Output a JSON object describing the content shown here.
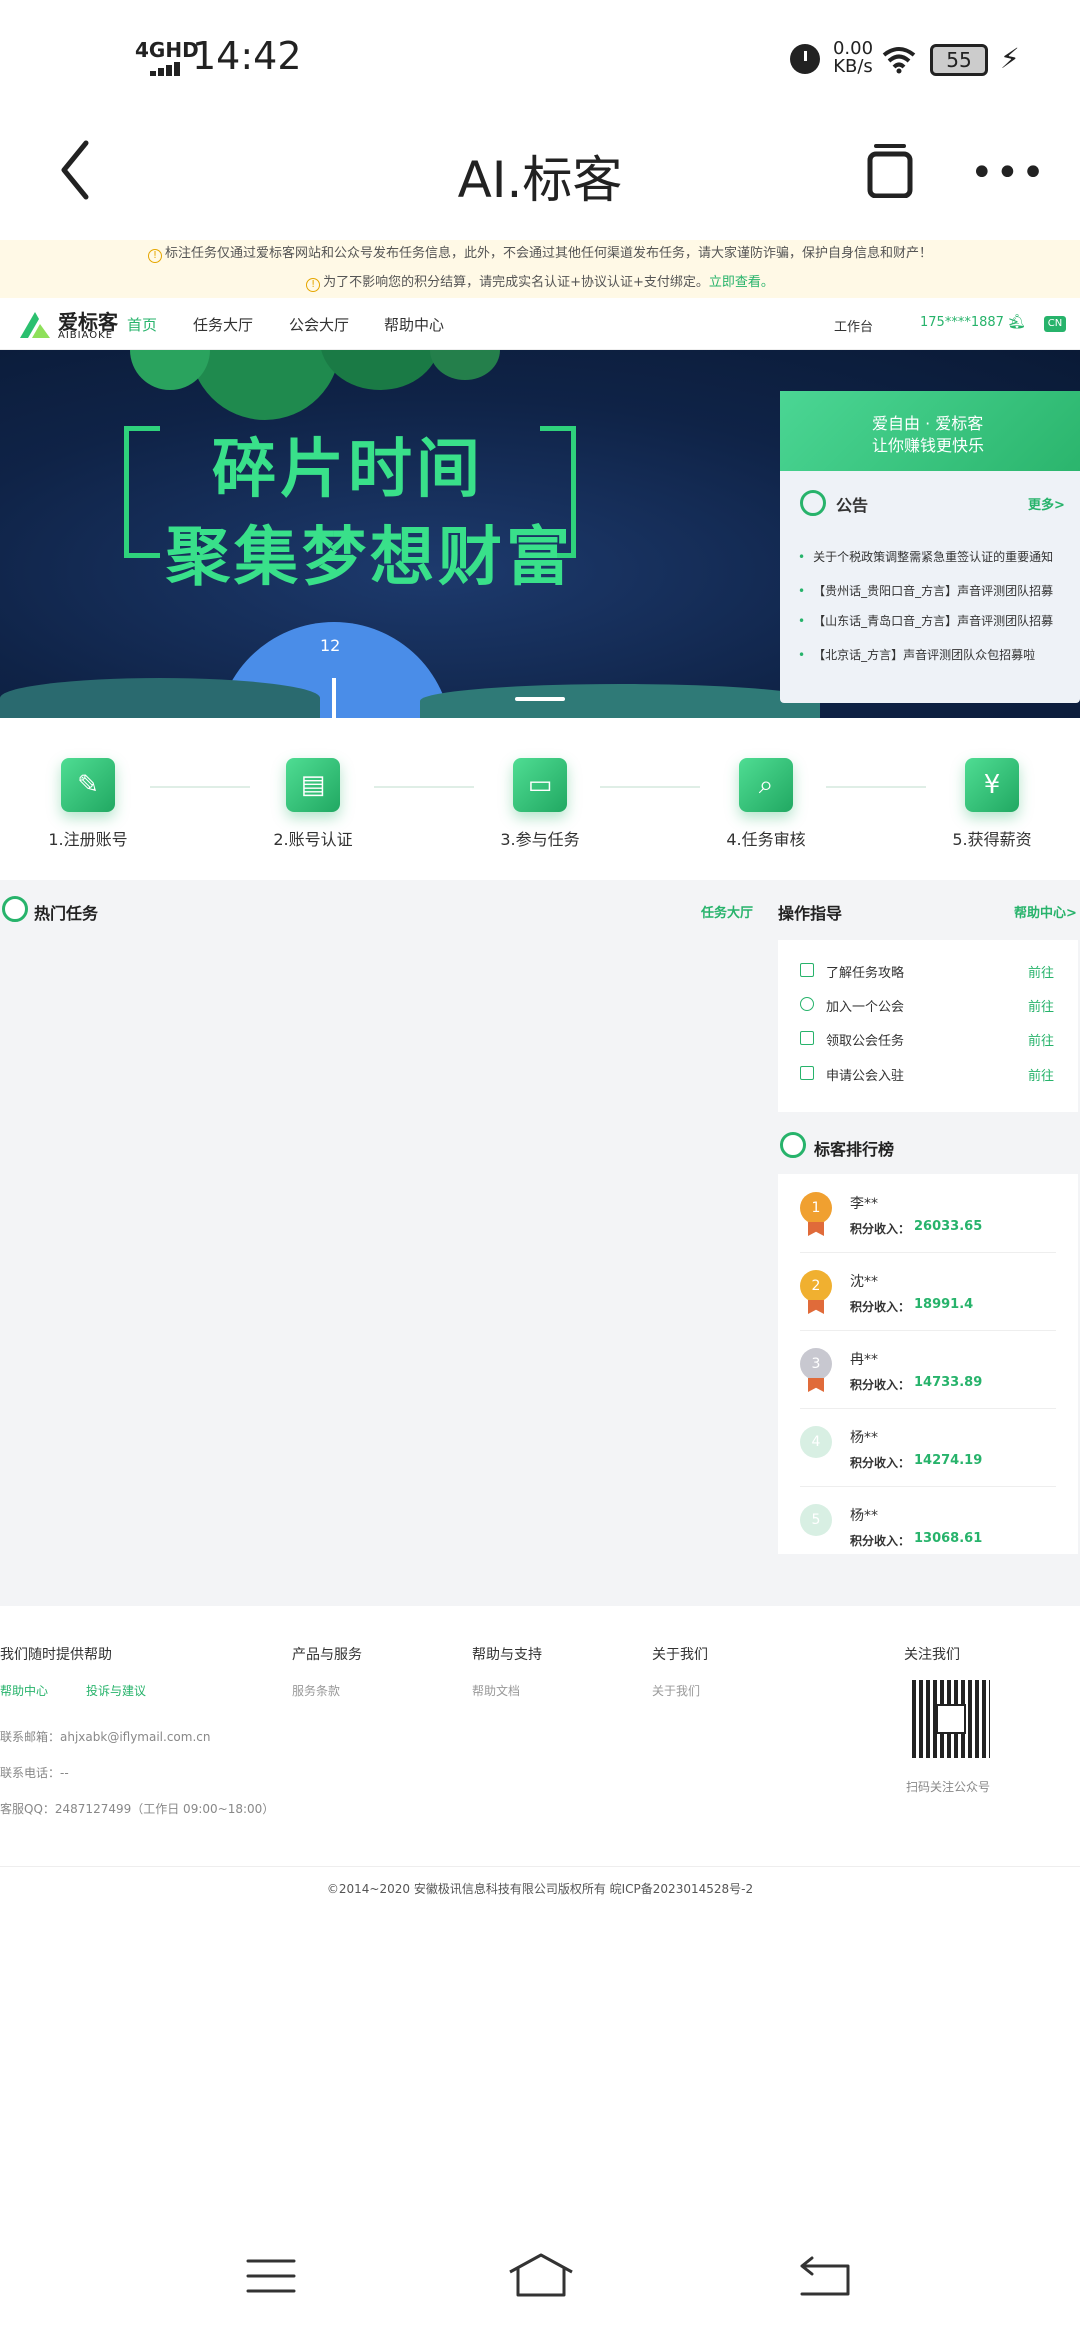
{
  "status_bar": {
    "network": "4GHD",
    "time": "14:42",
    "speed_value": "0.00",
    "speed_unit": "KB/s",
    "battery": "55"
  },
  "titlebar": {
    "title": "AI.标客"
  },
  "notices": {
    "line1": "标注任务仅通过爱标客网站和公众号发布任务信息，此外，不会通过其他任何渠道发布任务，请大家谨防诈骗，保护自身信息和财产！",
    "line2": "为了不影响您的积分结算，请完成实名认证+协议认证+支付绑定。",
    "line2_link": "立即查看。"
  },
  "webnav": {
    "logo_cn": "爱标客",
    "logo_en": "AIBIAOKE",
    "links": [
      "首页",
      "任务大厅",
      "公会大厅",
      "帮助中心"
    ],
    "workbench": "工作台",
    "phone": "175****1887 >",
    "lang": "CN"
  },
  "banner": {
    "line1": "碎片时间",
    "line2": "聚集梦想财富",
    "clock_num": "12"
  },
  "announcement": {
    "slogan1": "爱自由 · 爱标客",
    "slogan2": "让你赚钱更快乐",
    "title": "公告",
    "more": "更多>",
    "items": [
      "关于个税政策调整需紧急重签认证的重要通知",
      "【贵州话_贵阳口音_方言】声音评测团队招募",
      "【山东话_青岛口音_方言】声音评测团队招募",
      "【北京话_方言】声音评测团队众包招募啦"
    ]
  },
  "steps": [
    {
      "label": "1.注册账号",
      "icon": "feather-icon"
    },
    {
      "label": "2.账号认证",
      "icon": "id-card-icon"
    },
    {
      "label": "3.参与任务",
      "icon": "printer-icon"
    },
    {
      "label": "4.任务审核",
      "icon": "magnifier-icon"
    },
    {
      "label": "5.获得薪资",
      "icon": "yen-book-icon"
    }
  ],
  "hot_tasks": {
    "title": "热门任务",
    "more": "任务大厅"
  },
  "guide": {
    "title": "操作指导",
    "more": "帮助中心>",
    "items": [
      {
        "label": "了解任务攻略",
        "action": "前往"
      },
      {
        "label": "加入一个公会",
        "action": "前往"
      },
      {
        "label": "领取公会任务",
        "action": "前往"
      },
      {
        "label": "申请公会入驻",
        "action": "前往"
      }
    ]
  },
  "ranking": {
    "title": "标客排行榜",
    "income_label": "积分收入：",
    "items": [
      {
        "rank": "1",
        "name": "李**",
        "income": "26033.65",
        "color": "#f0a030"
      },
      {
        "rank": "2",
        "name": "沈**",
        "income": "18991.4",
        "color": "#f0b030"
      },
      {
        "rank": "3",
        "name": "冉**",
        "income": "14733.89",
        "color": "#c8c8d0"
      },
      {
        "rank": "4",
        "name": "杨**",
        "income": "14274.19",
        "color": "#d8efe3"
      },
      {
        "rank": "5",
        "name": "杨**",
        "income": "13068.61",
        "color": "#d8efe3"
      }
    ]
  },
  "footer": {
    "col1_title": "我们随时提供帮助",
    "col1_links": [
      "帮助中心",
      "投诉与建议"
    ],
    "col2_title": "产品与服务",
    "col2_link": "服务条款",
    "col3_title": "帮助与支持",
    "col3_link": "帮助文档",
    "col4_title": "关于我们",
    "col4_link": "关于我们",
    "col5_title": "关注我们",
    "email": "联系邮箱：ahjxabk@iflymail.com.cn",
    "phone": "联系电话：--",
    "qq": "客服QQ：2487127499（工作日 09:00~18:00）",
    "qr_caption": "扫码关注公众号",
    "copyright": "©2014~2020 安徽极讯信息科技有限公司版权所有 皖ICP备2023014528号-2"
  },
  "colors": {
    "accent": "#27b36b",
    "notice_bg": "#fff9e6",
    "banner_bg": "#0f2347"
  }
}
